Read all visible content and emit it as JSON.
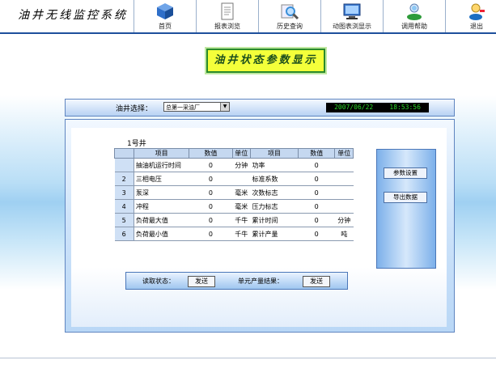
{
  "app": {
    "title": "油井无线监控系统"
  },
  "nav": [
    {
      "label": "首页",
      "icon": "home-cube-icon",
      "color": "#2f6fc9"
    },
    {
      "label": "报表浏览",
      "icon": "document-icon",
      "color": "#777777"
    },
    {
      "label": "历史查询",
      "icon": "magnifier-icon",
      "color": "#3a8fd8"
    },
    {
      "label": "动图表浏显示",
      "icon": "monitor-icon",
      "color": "#2a5aa0"
    },
    {
      "label": "调用帮助",
      "icon": "people-icon",
      "color": "#2e9b3a"
    },
    {
      "label": "退出",
      "icon": "exit-user-icon",
      "color": "#1b6ec2"
    }
  ],
  "page_title": "油井状态参数显示",
  "controls": {
    "well_select_label": "油井选择：",
    "well_select_value": "总第一采油厂",
    "date": "2007/06/22",
    "time": "18:53:56"
  },
  "well_name": "1号井",
  "table": {
    "headers": [
      "项目",
      "数值",
      "单位",
      "项目",
      "数值",
      "单位"
    ],
    "rows": [
      {
        "idx": "",
        "item1": "抽油机运行时间",
        "val1": "0",
        "unit1": "分钟",
        "item2": "功率",
        "val2": "0",
        "unit2": ""
      },
      {
        "idx": "2",
        "item1": "三相电压",
        "val1": "0",
        "unit1": "",
        "item2": "标准系数",
        "val2": "0",
        "unit2": ""
      },
      {
        "idx": "3",
        "item1": "泵深",
        "val1": "0",
        "unit1": "毫米",
        "item2": "次数标志",
        "val2": "0",
        "unit2": ""
      },
      {
        "idx": "4",
        "item1": "冲程",
        "val1": "0",
        "unit1": "毫米",
        "item2": "压力标志",
        "val2": "0",
        "unit2": ""
      },
      {
        "idx": "5",
        "item1": "负荷最大值",
        "val1": "0",
        "unit1": "千牛",
        "item2": "累计时间",
        "val2": "0",
        "unit2": "分钟"
      },
      {
        "idx": "6",
        "item1": "负荷最小值",
        "val1": "0",
        "unit1": "千牛",
        "item2": "累计产量",
        "val2": "0",
        "unit2": "吨"
      }
    ]
  },
  "side_buttons": {
    "params": "参数设置",
    "export": "导出数据"
  },
  "bottom": {
    "status_label": "读取状态：",
    "status_button": "发送",
    "production_label": "单元产量结果：",
    "production_button": "发送"
  }
}
